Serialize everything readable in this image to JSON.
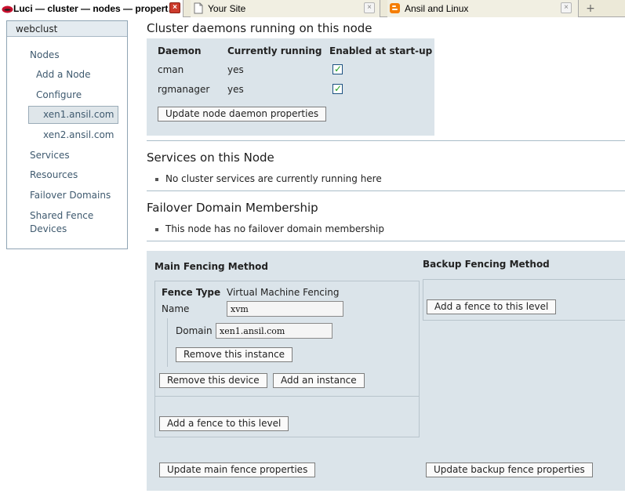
{
  "browser": {
    "tabs": [
      {
        "title": "Luci — cluster — nodes — propert…",
        "favicon": "redhat-icon",
        "active": true
      },
      {
        "title": "Your Site",
        "favicon": "page-icon",
        "active": false
      },
      {
        "title": "Ansil and Linux",
        "favicon": "blogger-icon",
        "active": false
      }
    ],
    "close_glyph": "×",
    "new_tab_glyph": "+"
  },
  "sidebar": {
    "cluster": "webclust",
    "items": [
      {
        "label": "Nodes"
      },
      {
        "label": "Add a Node"
      },
      {
        "label": "Configure"
      },
      {
        "label": "xen1.ansil.com",
        "selected": true
      },
      {
        "label": "xen2.ansil.com"
      },
      {
        "label": "Services"
      },
      {
        "label": "Resources"
      },
      {
        "label": "Failover Domains"
      },
      {
        "label": "Shared Fence"
      },
      {
        "label": "Devices"
      }
    ]
  },
  "daemons": {
    "heading": "Cluster daemons running on this node",
    "columns": [
      "Daemon",
      "Currently running",
      "Enabled at start-up"
    ],
    "rows": [
      {
        "name": "cman",
        "running": "yes",
        "enabled": true
      },
      {
        "name": "rgmanager",
        "running": "yes",
        "enabled": true
      }
    ],
    "update_button": "Update node daemon properties"
  },
  "services": {
    "heading": "Services on this Node",
    "message": "No cluster services are currently running here"
  },
  "failover": {
    "heading": "Failover Domain Membership",
    "message": "This node has no failover domain membership"
  },
  "fencing": {
    "main_title": "Main Fencing Method",
    "backup_title": "Backup Fencing Method",
    "fence_type_label": "Fence Type",
    "fence_type_value": "Virtual Machine Fencing",
    "name_label": "Name",
    "name_value": "xvm",
    "domain_label": "Domain",
    "domain_value": "xen1.ansil.com",
    "remove_instance": "Remove this instance",
    "remove_device": "Remove this device",
    "add_instance": "Add an instance",
    "add_fence_main": "Add a fence to this level",
    "add_fence_backup": "Add a fence to this level",
    "update_main": "Update main fence properties",
    "update_backup": "Update backup fence properties"
  },
  "colors": {
    "panel_bg": "#dbe4ea",
    "link": "#3f5a6f",
    "check": "#21a121"
  }
}
